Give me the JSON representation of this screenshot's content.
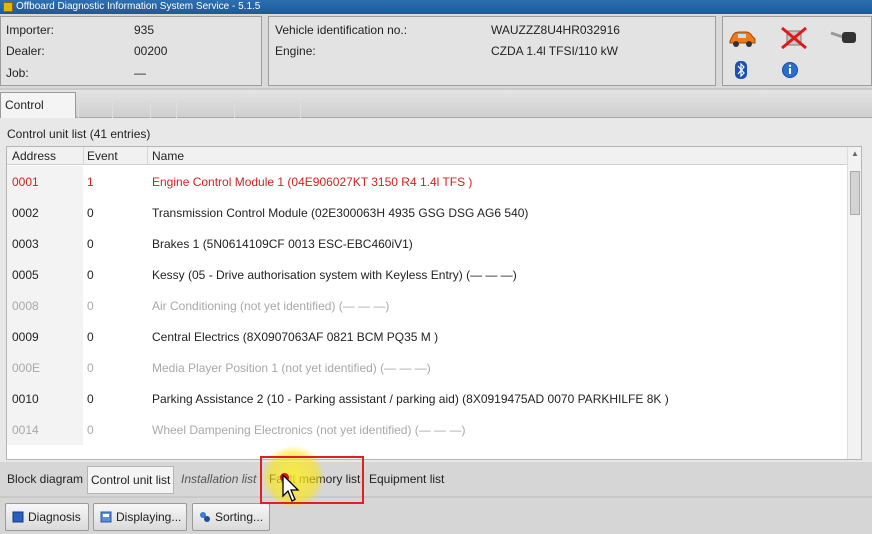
{
  "window": {
    "title": "Offboard Diagnostic Information System Service - 5.1.5"
  },
  "vehicle_info": {
    "importer_label": "Importer:",
    "importer_value": "935",
    "dealer_label": "Dealer:",
    "dealer_value": "00200",
    "job_label": "Job:",
    "job_value": "—",
    "vin_label": "Vehicle identification no.:",
    "vin_value": "WAUZZZ8U4HR032916",
    "engine_label": "Engine:",
    "engine_value": "CZDA 1.4l TFSI/110 kW"
  },
  "status_icons": [
    "car-icon",
    "disconnected-icon",
    "key-icon",
    "bluetooth-icon",
    "info-icon"
  ],
  "tabs": {
    "active": "Control units",
    "ghost": [
      "",
      "",
      "",
      "",
      "",
      ""
    ]
  },
  "control_unit_list": {
    "title": "Control unit list (41 entries)",
    "columns": {
      "address": "Address",
      "event": "Event",
      "name": "Name"
    },
    "rows": [
      {
        "address": "0001",
        "event": "1",
        "name": "Engine Control Module 1 (04E906027KT   3150   R4 1.4l TFS  )",
        "status": "fault"
      },
      {
        "address": "0002",
        "event": "0",
        "name": "Transmission Control Module (02E300063H     4935   GSG DSG AG6     540)",
        "status": "ok"
      },
      {
        "address": "0003",
        "event": "0",
        "name": "Brakes 1 (5N0614109CF   0013   ESC-EBC460iV1)",
        "status": "ok"
      },
      {
        "address": "0005",
        "event": "0",
        "name": "Kessy (05 - Drive authorisation system with Keyless Entry) (—  —  —)",
        "status": "ok"
      },
      {
        "address": "0008",
        "event": "0",
        "name": "Air Conditioning (not yet identified) (—  —  —)",
        "status": "unidentified"
      },
      {
        "address": "0009",
        "event": "0",
        "name": "Central Electrics (8X0907063AF   0821   BCM PQ35  M  )",
        "status": "ok"
      },
      {
        "address": "000E",
        "event": "0",
        "name": "Media Player Position 1 (not yet identified) (—  —  —)",
        "status": "unidentified"
      },
      {
        "address": "0010",
        "event": "0",
        "name": "Parking Assistance 2 (10 - Parking assistant / parking aid) (8X0919475AD    0070    PARKHILFE 8K )",
        "status": "ok"
      },
      {
        "address": "0014",
        "event": "0",
        "name": "Wheel Dampening Electronics (not yet identified) (—  —  —)",
        "status": "unidentified"
      }
    ]
  },
  "view_tabs": [
    "Block diagram",
    "Control unit list",
    "Installation list",
    "Fault memory list",
    "Equipment list"
  ],
  "view_tabs_active": "Control unit list",
  "bottom_buttons": {
    "diagnosis": "Diagnosis",
    "displaying": "Displaying...",
    "sorting": "Sorting..."
  },
  "colors": {
    "fault": "#d62020",
    "unidentified": "#a8a8a8",
    "title_bar": "#2d6fb0",
    "highlight": "#e02020"
  }
}
